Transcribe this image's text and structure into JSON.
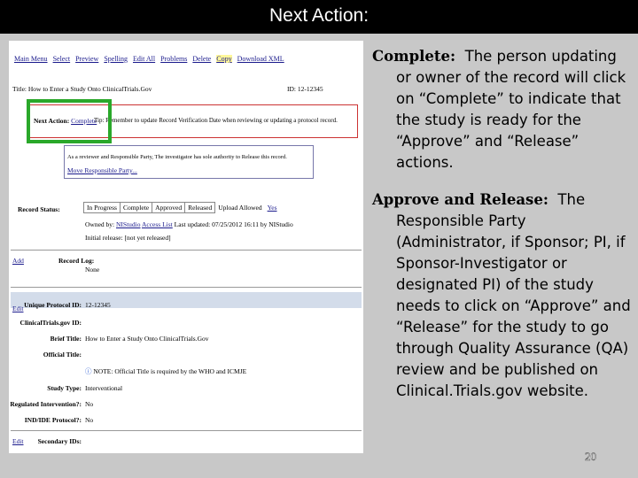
{
  "slide": {
    "title": "Next Action:",
    "page_number": "20"
  },
  "screenshot": {
    "menu": [
      "Main Menu",
      "Select",
      "Preview",
      "Spelling",
      "Edit All",
      "Problems",
      "Delete",
      "Copy",
      "Download XML"
    ],
    "record_title": "Title: How to Enter a Study Onto ClinicalTrials.Gov",
    "record_id": "ID: 12-12345",
    "next_action_label": "Next Action:",
    "complete_link": "Complete",
    "tip_text": "Tip: Remember to update Record Verification Date when reviewing or updating a protocol record.",
    "info_text": "As a reviewer and Responsible Party, The investigator has sole authority to Release this record.",
    "info_link": "Move Responsible Party...",
    "record_status_label": "Record Status:",
    "status_cells": [
      "In Progress",
      "Complete",
      "Approved",
      "Released",
      "Upload Allowed",
      "Yes"
    ],
    "owned_by_label": "Owned by:",
    "owner": "NIStudio",
    "access_list": "Access List",
    "last_updated": "Last updated: 07/25/2012 16:11 by NIStudio",
    "initial_release_label": "Initial release:",
    "initial_release_value": "[not yet released]",
    "add_link": "Add",
    "record_log_label": "Record Log:",
    "record_log_value": "None",
    "edit_link": "Edit",
    "fields": [
      {
        "label": "Unique Protocol ID:",
        "value": "12-12345"
      },
      {
        "label": "ClinicalTrials.gov ID:",
        "value": ""
      },
      {
        "label": "Brief Title:",
        "value": "How to Enter a Study Onto ClinicalTrials.Gov"
      },
      {
        "label": "Official Title:",
        "value": ""
      },
      {
        "label": "Study Type:",
        "value": "Interventional"
      },
      {
        "label": "FDA Regulated Intervention?:",
        "value": "No"
      },
      {
        "label": "IND/IDE Protocol?:",
        "value": "No"
      },
      {
        "label": "Secondary IDs:",
        "value": ""
      }
    ],
    "note_text": "NOTE: Official Title is required by the WHO and ICMJE",
    "edit_link_2": "Edit"
  },
  "explanation": {
    "complete_term": "Complete:",
    "complete_text": "The person updating or owner of the record will click on “Complete” to indicate that the study is ready for the “Approve” and “Release” actions.",
    "approve_term": "Approve and Release:",
    "approve_text": "The Responsible Party (Administrator, if Sponsor; PI, if Sponsor-Investigator or designated PI) of the study needs to click on “Approve” and “Release” for the study to go through Quality Assurance (QA) review and be published on Clinical.Trials.gov website."
  }
}
